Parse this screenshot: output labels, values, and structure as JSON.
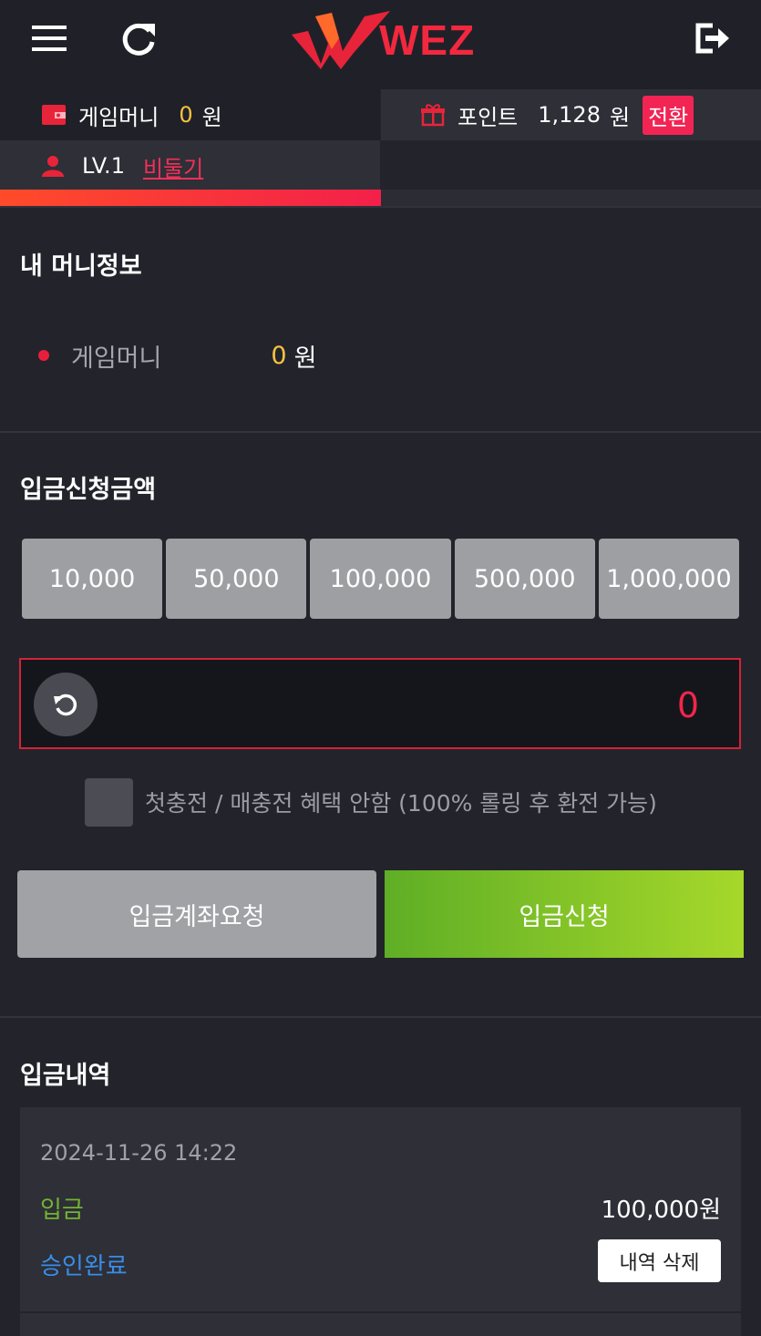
{
  "header": {
    "logo_text": "WEZ",
    "icons": [
      "menu-icon",
      "refresh-icon",
      "logout-icon"
    ],
    "accent_color": "#f2283f"
  },
  "wallet": {
    "game_money_label": "게임머니",
    "game_money_value": "0",
    "currency": "원",
    "point_label": "포인트",
    "point_value": "1,128",
    "convert_label": "전환",
    "level_label": "LV.1",
    "nickname": "비둘기",
    "level_progress": 0.5
  },
  "money_info": {
    "title": "내 머니정보",
    "game_money_label": "게임머니",
    "game_money_value": "0",
    "currency": "원"
  },
  "deposit": {
    "title": "입금신청금액",
    "amount_options": [
      "10,000",
      "50,000",
      "100,000",
      "500,000",
      "1,000,000"
    ],
    "amount_value": "0",
    "checkbox_label": "첫충전 / 매충전 혜택 안함 (100% 롤링 후 환전 가능)",
    "checkbox_checked": false,
    "account_request_label": "입금계좌요청",
    "submit_label": "입금신청"
  },
  "history": {
    "title": "입금내역",
    "items": [
      {
        "date": "2024-11-26 14:22",
        "type": "입금",
        "amount": "100,000원",
        "status": "승인완료",
        "delete_label": "내역 삭제"
      }
    ]
  }
}
